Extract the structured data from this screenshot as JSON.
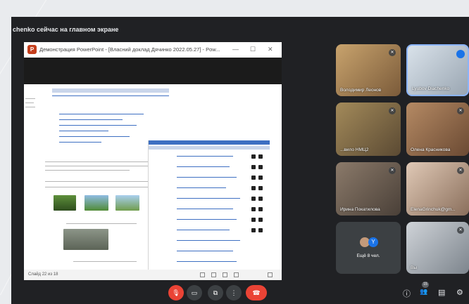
{
  "meet": {
    "presenting_banner": "chenko сейчас на главном экране"
  },
  "ppt": {
    "title": "Демонстрация PowerPoint - [Власний доклад Дячинко 2022.05.27] - Pow...",
    "logo_letter": "P",
    "minimize": "—",
    "restore": "☐",
    "close": "✕",
    "status_text": "Слайд 22 из 18"
  },
  "participants": [
    {
      "name": "Володимир Леонов",
      "muted": true
    },
    {
      "name": "Lyubov Diachenko",
      "speaking": true
    },
    {
      "name": "...вило НМЦ2",
      "muted": true
    },
    {
      "name": "Олена Красникова",
      "muted": true
    },
    {
      "name": "Ирина Покатилова",
      "muted": true
    },
    {
      "name": "ElenaGrinchuk@gm...",
      "muted": true
    },
    {
      "name": "Ещё 8 чел.",
      "avatar_letter": "Y"
    },
    {
      "name": "Вы",
      "muted": true
    }
  ],
  "controls": {
    "mic": "🎙",
    "camera": "▭",
    "present": "⧉",
    "more": "⋮",
    "hangup": "☎",
    "info": "ⓘ",
    "people": "👥",
    "people_count": "15",
    "chat": "▤",
    "activities": "⚙"
  },
  "colors": {
    "meet_bg": "#202124",
    "accent_blue": "#1a73e8",
    "hangup_red": "#ea4335",
    "ppt_orange": "#c43e1c"
  }
}
